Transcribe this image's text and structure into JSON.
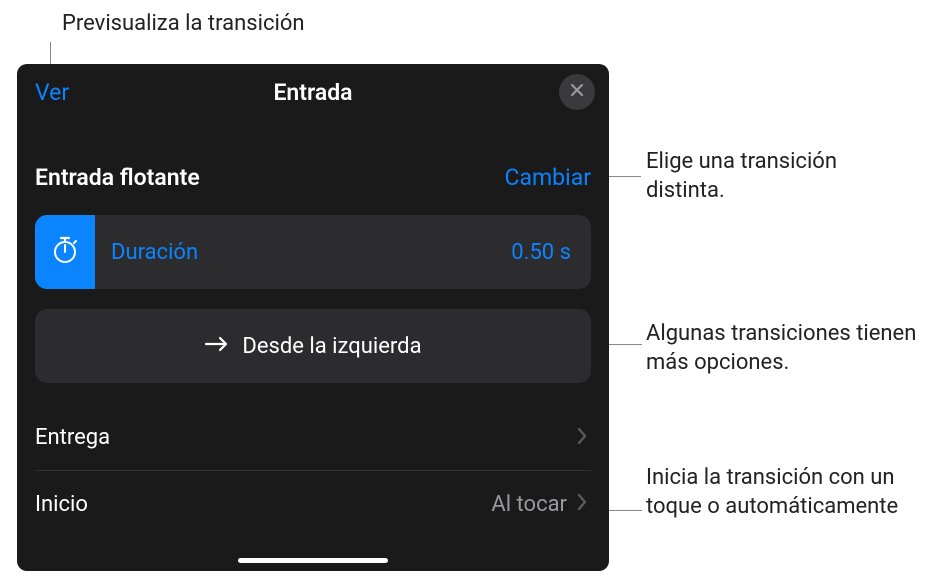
{
  "callouts": {
    "preview": "Previsualiza la transición",
    "change": "Elige una transición distinta.",
    "direction": "Algunas transiciones tienen más opciones.",
    "start": "Inicia la transición con un toque o automáticamente"
  },
  "header": {
    "preview_label": "Ver",
    "title": "Entrada"
  },
  "effect": {
    "name": "Entrada flotante",
    "change_label": "Cambiar"
  },
  "duration": {
    "label": "Duración",
    "value": "0.50 s"
  },
  "direction": {
    "label": "Desde la izquierda"
  },
  "rows": {
    "delivery_label": "Entrega",
    "start_label": "Inicio",
    "start_value": "Al tocar"
  }
}
